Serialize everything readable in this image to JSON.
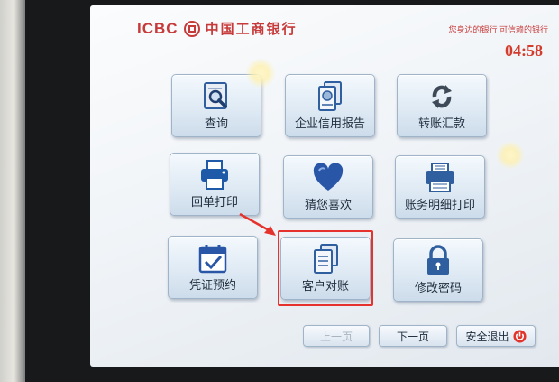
{
  "header": {
    "brand_en": "ICBC",
    "brand_cn": "中国工商银行",
    "tagline": "您身边的银行  可信赖的银行",
    "countdown": "04:58"
  },
  "menu": {
    "inquiry": "查询",
    "credit_report": "企业信用报告",
    "transfer": "转账汇款",
    "receipt_print": "回单打印",
    "guess_like": "猜您喜欢",
    "statement_print": "账务明细打印",
    "voucher_booking": "凭证预约",
    "reconciliation": "客户对账",
    "change_password": "修改密码"
  },
  "nav": {
    "prev": "上一页",
    "next": "下一页",
    "exit": "安全退出"
  },
  "colors": {
    "brand_red": "#c73a3a",
    "highlight": "#e5322d",
    "icon_blue": "#2f5f9e",
    "heart_blue": "#2a56a8"
  },
  "icons": {
    "inquiry": "magnifier-document-icon",
    "credit_report": "report-document-icon",
    "transfer": "refresh-arrows-icon",
    "receipt_print": "printer-icon",
    "guess_like": "heart-icon",
    "statement_print": "printer-paper-icon",
    "voucher_booking": "calendar-check-icon",
    "reconciliation": "documents-icon",
    "change_password": "padlock-icon",
    "exit": "power-icon"
  }
}
